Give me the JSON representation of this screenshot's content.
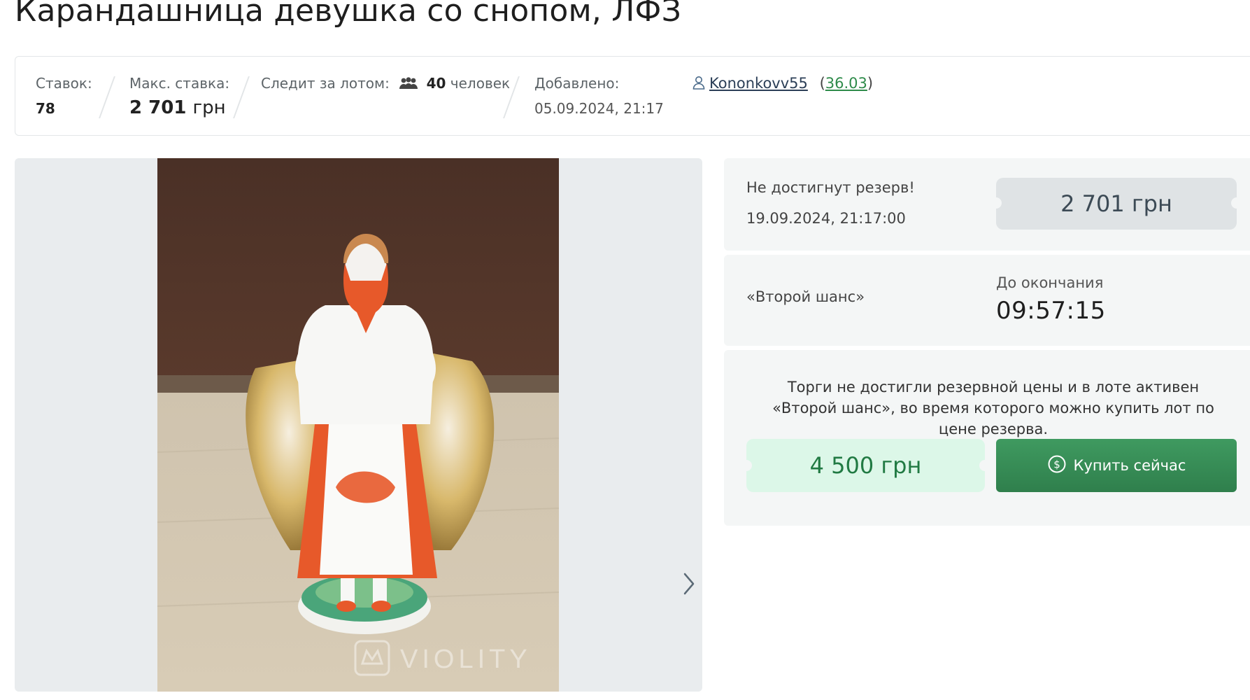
{
  "lot": {
    "title": "Карандашница девушка со снопом, ЛФЗ"
  },
  "stats": {
    "bids_label": "Ставок:",
    "bids_value": "78",
    "max_bid_label": "Макс. ставка:",
    "max_bid_amount": "2 701",
    "max_bid_currency": "грн",
    "watch_label": "Следит за лотом:",
    "watch_count": "40",
    "watch_suffix": "человек",
    "added_label": "Добавлено:",
    "added_value": "05.09.2024, 21:17",
    "seller_name": "Kononkovv55",
    "seller_rating": "36.03"
  },
  "gallery": {
    "watermark": "VIOLITY",
    "next_icon": "chevron-right-icon"
  },
  "reserve_panel": {
    "status": "Не достигнут резерв!",
    "end_date": "19.09.2024, 21:17:00",
    "current_price": "2 701 грн"
  },
  "timer_panel": {
    "second_chance": "«Второй шанс»",
    "ends_label": "До окончания",
    "time_left": "09:57:15"
  },
  "buy_panel": {
    "info": "Торги не достигли резервной цены и в лоте активен «Второй шанс», во время которого можно купить лот по цене резерва.",
    "buynow_price": "4 500 грн",
    "buy_button": "Купить сейчас",
    "buy_icon": "dollar-circle-icon"
  },
  "colors": {
    "accent_green": "#2f7f4c",
    "price_green_bg": "#dcf7e8",
    "panel_bg": "#f4f6f6"
  }
}
